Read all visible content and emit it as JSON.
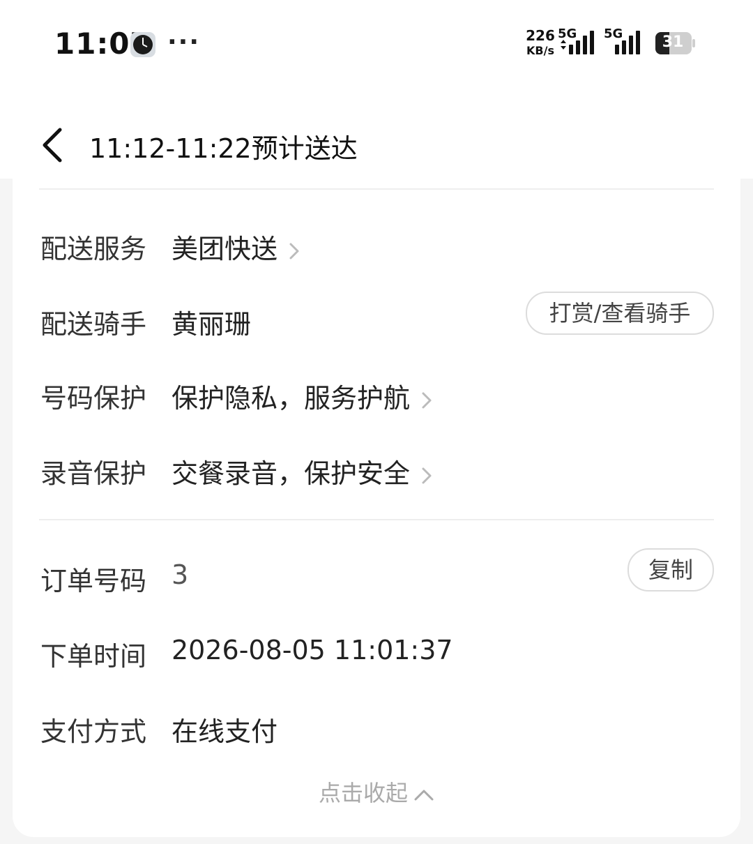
{
  "status_bar": {
    "time": "11:07",
    "more": "···",
    "net_speed_value": "226",
    "net_speed_unit": "KB/s",
    "sim1_label": "5G",
    "sim2_label": "5G",
    "battery_level": "31"
  },
  "header": {
    "title": "11:12-11:22预计送达"
  },
  "rows": {
    "delivery_service": {
      "label": "配送服务",
      "value": "美团快送"
    },
    "rider": {
      "label": "配送骑手",
      "value": "黄丽珊",
      "button": "打赏/查看骑手"
    },
    "number_protect": {
      "label": "号码保护",
      "value": "保护隐私，服务护航"
    },
    "recording_protect": {
      "label": "录音保护",
      "value": "交餐录音，保护安全"
    },
    "order_number": {
      "label": "订单号码",
      "value": "3",
      "button": "复制"
    },
    "order_time": {
      "label": "下单时间",
      "value": "2026-08-05 11:01:37"
    },
    "payment": {
      "label": "支付方式",
      "value": "在线支付"
    }
  },
  "collapse_label": "点击收起",
  "colors": {
    "background": "#f5f5f5",
    "card": "#ffffff",
    "muted_text": "#aaaaaa",
    "border": "#dcdcdc"
  }
}
